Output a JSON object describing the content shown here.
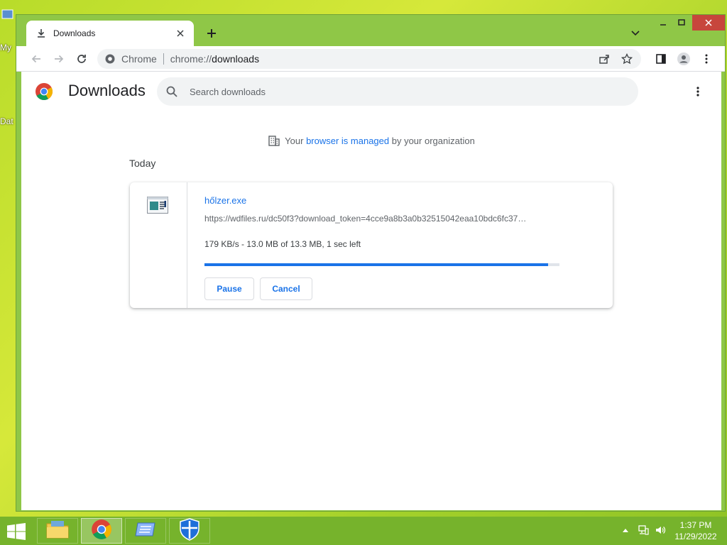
{
  "desktop": {
    "icon_labels": [
      "My",
      "Dat"
    ]
  },
  "browser": {
    "tab_title": "Downloads",
    "address_chip": "Chrome",
    "url_scheme": "chrome://",
    "url_path": "downloads"
  },
  "downloads_page": {
    "title": "Downloads",
    "search_placeholder": "Search downloads",
    "managed_prefix": "Your ",
    "managed_link": "browser is managed",
    "managed_suffix": " by your organization",
    "date_header": "Today",
    "item": {
      "file_name": "hőlzer.exe",
      "url": "https://wdfiles.ru/dc50f3?download_token=4cce9a8b3a0b32515042eaa10bdc6fc37…",
      "status": "179 KB/s - 13.0 MB of 13.3 MB, 1 sec left",
      "progress_fraction": 0.968,
      "pause_label": "Pause",
      "cancel_label": "Cancel"
    }
  },
  "taskbar": {
    "time": "1:37 PM",
    "date": "11/29/2022",
    "apps": [
      "file-explorer",
      "chrome",
      "disk-utility",
      "windows-defender"
    ]
  },
  "colors": {
    "accent": "#1a73e8",
    "window_frame": "#8fc747",
    "taskbar": "#76b32c",
    "close_button": "#c7463c"
  }
}
